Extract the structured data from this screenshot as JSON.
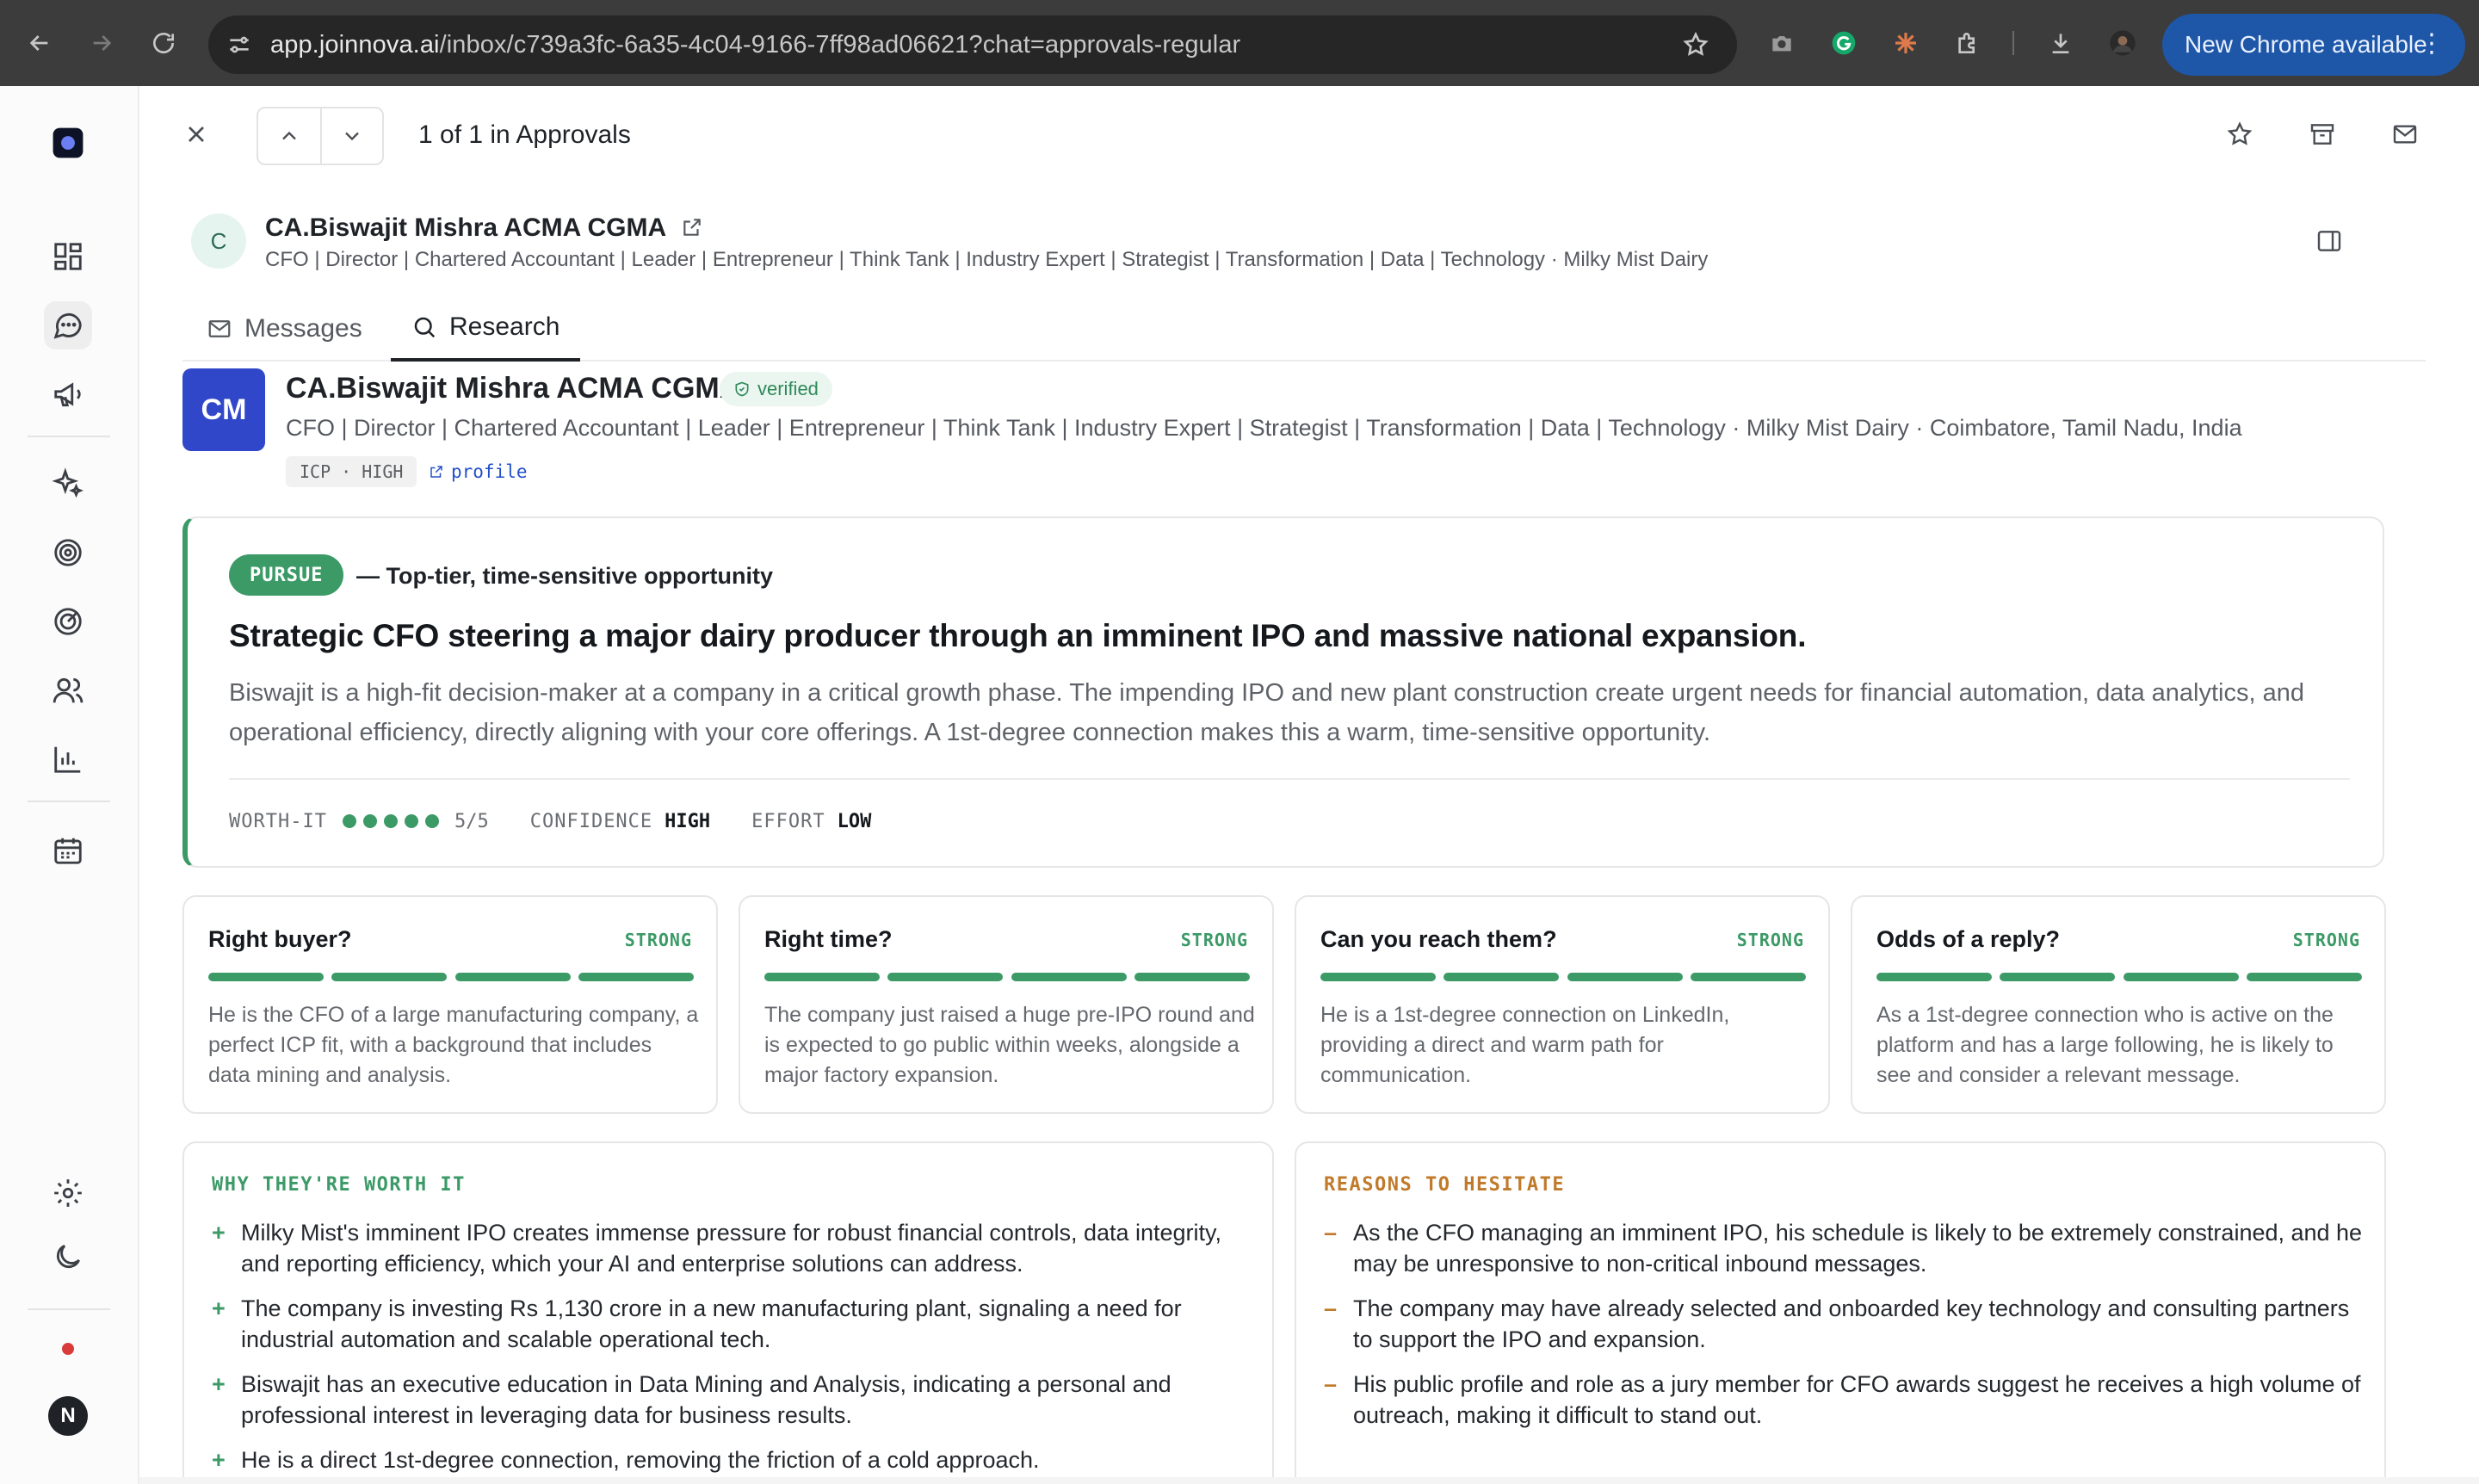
{
  "browser": {
    "url_host": "app.joinnova.ai",
    "url_path": "/inbox/c739a3fc-6a35-4c04-9166-7ff98ad06621?chat=approvals-regular",
    "update_label": "New Chrome available"
  },
  "toolbar": {
    "position_text": "1 of 1 in Approvals"
  },
  "contact": {
    "initial": "C",
    "name": "CA.Biswajit Mishra ACMA CGMA",
    "subtitle": "CFO | Director | Chartered Accountant | Leader | Entrepreneur | Think Tank | Industry Expert | Strategist | Transformation | Data | Technology · Milky Mist Dairy"
  },
  "tabs": [
    {
      "label": "Messages"
    },
    {
      "label": "Research"
    }
  ],
  "research": {
    "badge": "CM",
    "name": "CA.Biswajit Mishra ACMA CGMA",
    "verified_label": "verified",
    "subtitle": "CFO | Director | Chartered Accountant | Leader | Entrepreneur | Think Tank | Industry Expert | Strategist | Transformation | Data | Technology · Milky Mist Dairy · Coimbatore, Tamil Nadu, India",
    "icp_label": "ICP · HIGH",
    "profile_label": "profile"
  },
  "verdict": {
    "decision": "PURSUE",
    "tagline": "— Top-tier, time-sensitive opportunity",
    "headline": "Strategic CFO steering a major dairy producer through an imminent IPO and massive national expansion.",
    "summary": "Biswajit is a high-fit decision-maker at a company in a critical growth phase. The impending IPO and new plant construction create urgent needs for financial automation, data analytics, and operational efficiency, directly aligning with your core offerings. A 1st-degree connection makes this a warm, time-sensitive opportunity.",
    "worth_label": "WORTH-IT",
    "worth_score": 5,
    "worth_text": "5/5",
    "confidence_label": "CONFIDENCE",
    "confidence_value": "HIGH",
    "effort_label": "EFFORT",
    "effort_value": "LOW",
    "accent_color": "#3c9a67"
  },
  "signals": [
    {
      "title": "Right buyer?",
      "strength": "STRONG",
      "level": 4,
      "text": "He is the CFO of a large manufacturing company, a perfect ICP fit, with a background that includes data mining and analysis."
    },
    {
      "title": "Right time?",
      "strength": "STRONG",
      "level": 4,
      "text": "The company just raised a huge pre-IPO round and is expected to go public within weeks, alongside a major factory expansion."
    },
    {
      "title": "Can you reach them?",
      "strength": "STRONG",
      "level": 4,
      "text": "He is a 1st-degree connection on LinkedIn, providing a direct and warm path for communication."
    },
    {
      "title": "Odds of a reply?",
      "strength": "STRONG",
      "level": 4,
      "text": "As a 1st-degree connection who is active on the platform and has a large following, he is likely to see and consider a relevant message."
    }
  ],
  "worth": {
    "heading": "WHY THEY'RE WORTH IT",
    "items": [
      "Milky Mist's imminent IPO creates immense pressure for robust financial controls, data integrity, and reporting efficiency, which your AI and enterprise solutions can address.",
      "The company is investing Rs 1,130 crore in a new manufacturing plant, signaling a need for industrial automation and scalable operational tech.",
      "Biswajit has an executive education in Data Mining and Analysis, indicating a personal and professional interest in leveraging data for business results.",
      "He is a direct 1st-degree connection, removing the friction of a cold approach."
    ]
  },
  "hesitate": {
    "heading": "REASONS TO HESITATE",
    "items": [
      "As the CFO managing an imminent IPO, his schedule is likely to be extremely constrained, and he may be unresponsive to non-critical inbound messages.",
      "The company may have already selected and onboarded key technology and consulting partners to support the IPO and expansion.",
      "His public profile and role as a jury member for CFO awards suggest he receives a high volume of outreach, making it difficult to stand out."
    ]
  },
  "user": {
    "initial": "N"
  }
}
